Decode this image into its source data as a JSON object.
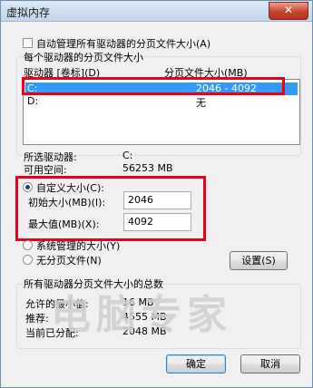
{
  "window": {
    "title": "虚拟内存",
    "close_glyph": "✕"
  },
  "auto_manage": {
    "label": "自动管理所有驱动器的分页文件大小(A)",
    "checked": false
  },
  "per_drive": {
    "legend": "每个驱动器的分页文件大小",
    "col_drive": "驱动器 [卷标](D)",
    "col_size": "分页文件大小(MB)",
    "rows": [
      {
        "drive": "C:",
        "size": "2046 - 4092",
        "selected": true
      },
      {
        "drive": "D:",
        "size": "无",
        "selected": false
      }
    ]
  },
  "selected_drive": {
    "label": "所选驱动器:",
    "value": "C:"
  },
  "free_space": {
    "label": "可用空间:",
    "value": "56253 MB"
  },
  "custom_size": {
    "label": "自定义大小(C):",
    "checked": true,
    "initial_label": "初始大小(MB)(I):",
    "initial_value": "2046",
    "max_label": "最大值(MB)(X):",
    "max_value": "4092"
  },
  "system_managed": {
    "label": "系统管理的大小(Y)",
    "checked": false
  },
  "no_paging": {
    "label": "无分页文件(N)",
    "checked": false
  },
  "set_button": "设置(S)",
  "totals": {
    "legend": "所有驱动器分页文件大小的总数",
    "min_label": "允许的最小值:",
    "min_value": "16 MB",
    "recommended_label": "推荐:",
    "recommended_value": "4555 MB",
    "allocated_label": "当前已分配:",
    "allocated_value": "2048 MB"
  },
  "ok_button": "确定",
  "cancel_button": "取消",
  "watermark": "电脑专家",
  "colors": {
    "highlight_box": "#e8001c",
    "selection": "#3399ff"
  }
}
